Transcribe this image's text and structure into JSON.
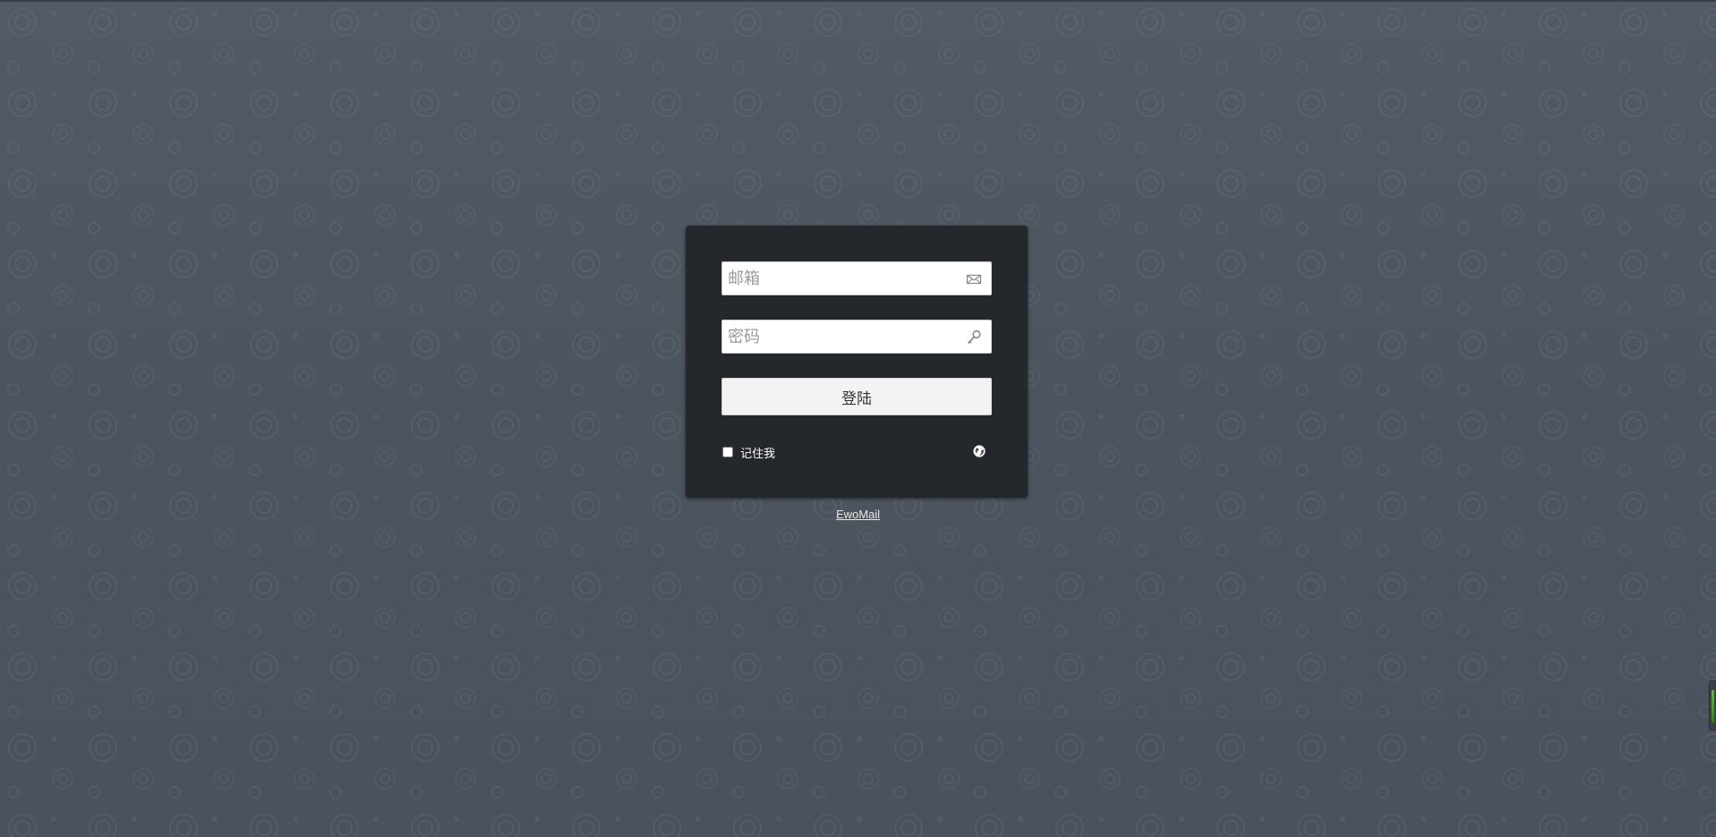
{
  "login": {
    "email_placeholder": "邮箱",
    "password_placeholder": "密码",
    "submit_label": "登陆",
    "remember_label": "记住我",
    "email_icon": "envelope-icon",
    "password_icon": "key-icon",
    "language_icon": "globe-icon"
  },
  "footer": {
    "link_text": "EwoMail"
  },
  "colors": {
    "background": "#4a525d",
    "panel": "#24272b",
    "button": "#f3f3f3",
    "link": "#e6e6e6"
  }
}
